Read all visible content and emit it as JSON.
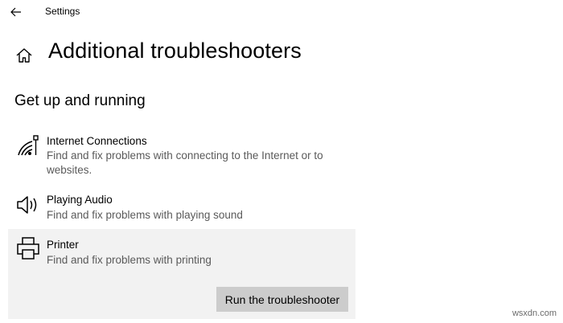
{
  "window": {
    "title": "Settings"
  },
  "header": {
    "back_icon": "back-arrow-icon",
    "home_icon": "home-icon",
    "page_title": "Additional troubleshooters"
  },
  "section": {
    "title": "Get up and running"
  },
  "troubleshooters": [
    {
      "name": "Internet Connections",
      "description": "Find and fix problems with connecting to the Internet or to websites.",
      "icon": "wifi-icon"
    },
    {
      "name": "Playing Audio",
      "description": "Find and fix problems with playing sound",
      "icon": "speaker-icon"
    },
    {
      "name": "Printer",
      "description": "Find and fix problems with printing",
      "icon": "printer-icon",
      "selected": true,
      "action_label": "Run the troubleshooter"
    }
  ],
  "watermark": "wsxdn.com",
  "colors": {
    "selected_bg": "#f2f2f2",
    "button_bg": "#cccccc",
    "secondary_text": "#5a5a5a"
  }
}
